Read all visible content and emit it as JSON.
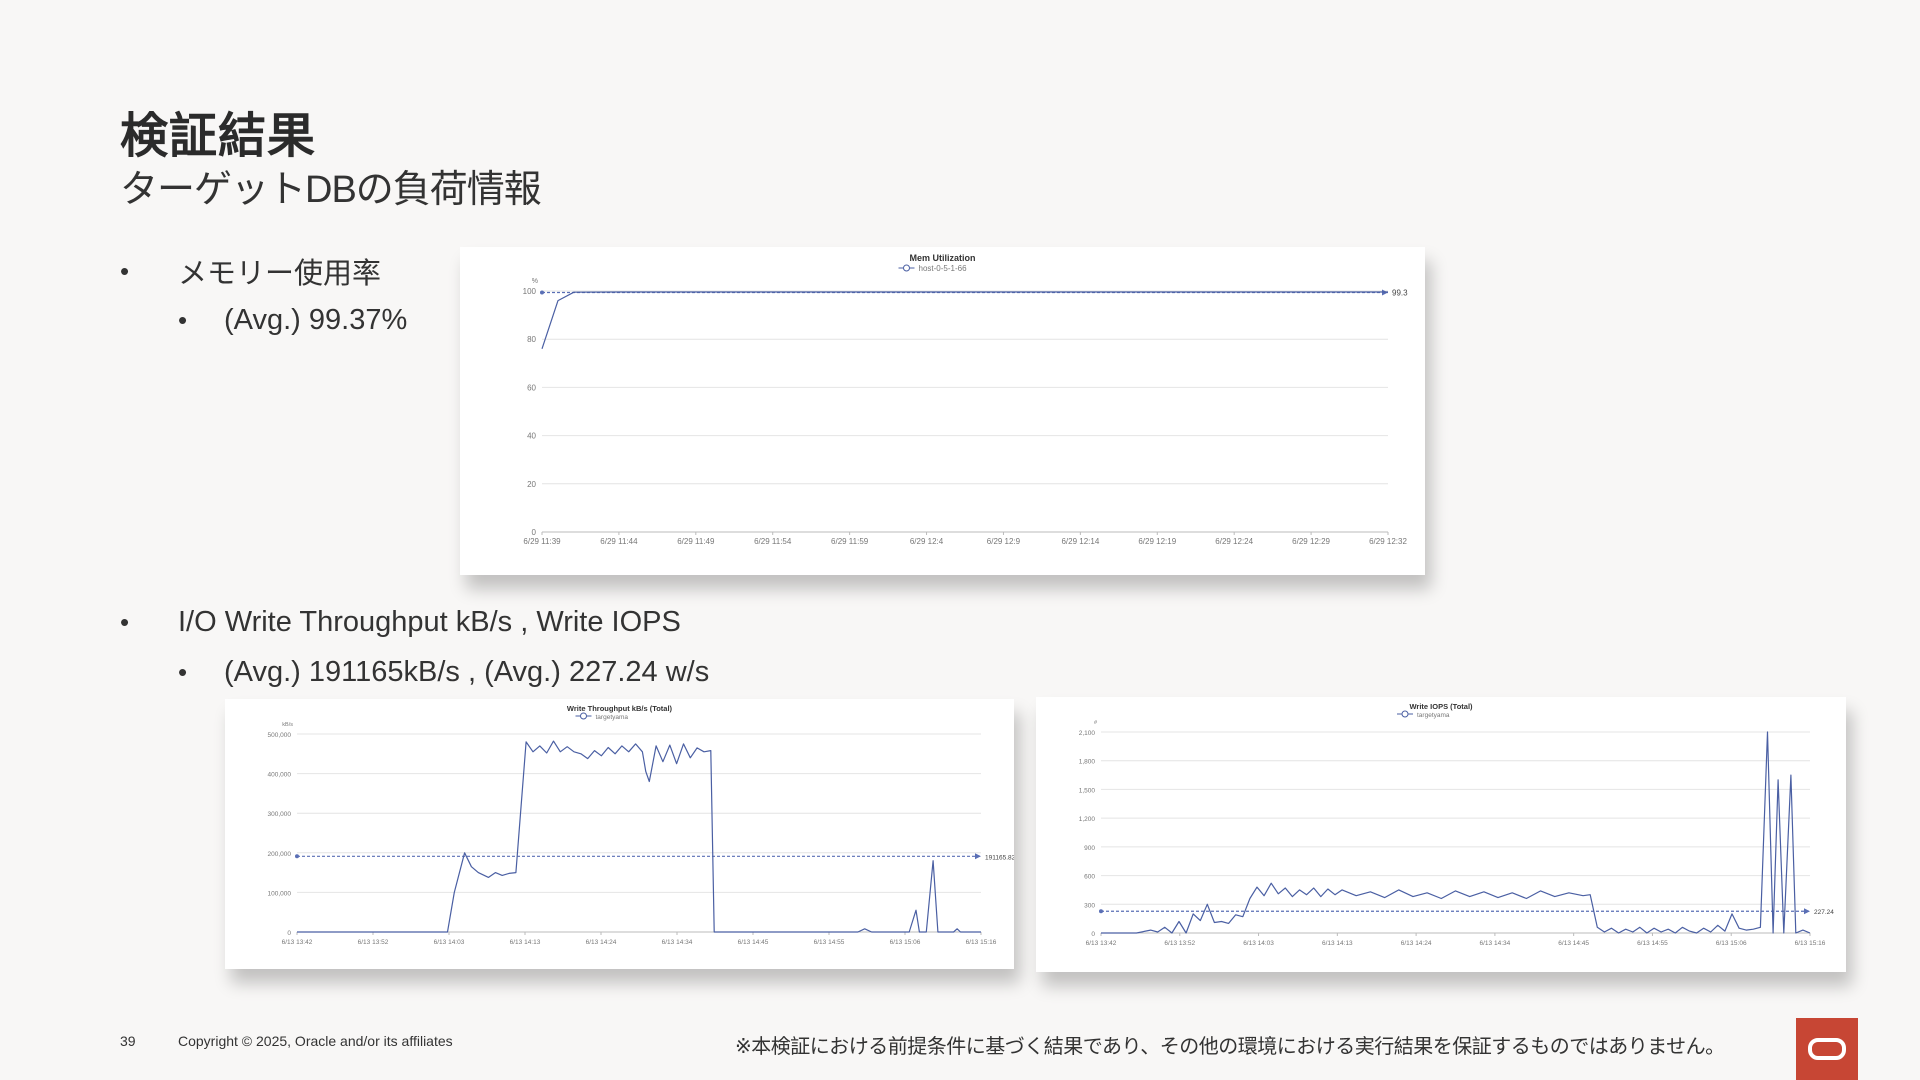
{
  "slide": {
    "title": "検証結果",
    "subtitle": "ターゲットDBの負荷情報",
    "bullets": {
      "mem_label": "メモリー使用率",
      "mem_avg": "(Avg.) 99.37%",
      "io_label": "I/O Write Throughput kB/s , Write IOPS",
      "io_avg": "(Avg.) 191165kB/s , (Avg.) 227.24 w/s"
    },
    "footer": {
      "page_number": "39",
      "copyright": "Copyright © 2025, Oracle and/or its affiliates",
      "disclaimer": "※本検証における前提条件に基づく結果であり、その他の環境における実行結果を保証するものではありません。"
    }
  },
  "colors": {
    "line": "#4a5fa3",
    "avg_line": "#5a6fb5",
    "grid": "#e4e4e4",
    "axis_text": "#777777",
    "oracle_red": "#c74634"
  },
  "chart_data": [
    {
      "type": "line",
      "title": "Mem Utilization",
      "series": [
        {
          "name": "host-0-5-1-66",
          "x": [
            "6/29 11:39",
            "6/29 11:40",
            "6/29 11:41",
            "6/29 11:44",
            "6/29 11:49",
            "6/29 11:54",
            "6/29 11:59",
            "6/29 12:04",
            "6/29 12:09",
            "6/29 12:14",
            "6/29 12:19",
            "6/29 12:24",
            "6/29 12:29",
            "6/29 12:32"
          ],
          "values": [
            76,
            96,
            99.5,
            99.6,
            99.6,
            99.6,
            99.6,
            99.6,
            99.6,
            99.6,
            99.6,
            99.6,
            99.6,
            99.6
          ]
        }
      ],
      "yunit": "%",
      "yticks": [
        "0",
        "20",
        "40",
        "60",
        "80",
        "100"
      ],
      "xticks": [
        "6/29 11:39",
        "6/29 11:44",
        "6/29 11:49",
        "6/29 11:54",
        "6/29 11:59",
        "6/29 12:4",
        "6/29 12:9",
        "6/29 12:14",
        "6/29 12:19",
        "6/29 12:24",
        "6/29 12:29",
        "6/29 12:32"
      ],
      "ylim": [
        0,
        100
      ],
      "x_range": [
        0,
        53
      ],
      "x_offsets": [
        0,
        1,
        2,
        5,
        10,
        15,
        20,
        25,
        30,
        35,
        40,
        45,
        50,
        53
      ],
      "avg": 99.37,
      "avg_label": "99.3",
      "legend_position": "top-center"
    },
    {
      "type": "line",
      "title": "Write Throughput kB/s (Total)",
      "series": [
        {
          "name": "targetyama",
          "x_range": [
            0,
            100
          ],
          "points": [
            [
              0,
              0
            ],
            [
              12,
              0
            ],
            [
              22,
              0
            ],
            [
              23,
              100000
            ],
            [
              24.5,
              200000
            ],
            [
              25.5,
              165000
            ],
            [
              26.5,
              150000
            ],
            [
              28,
              138000
            ],
            [
              29,
              150000
            ],
            [
              30,
              143000
            ],
            [
              31,
              148000
            ],
            [
              32,
              150000
            ],
            [
              33.5,
              480000
            ],
            [
              34.5,
              455000
            ],
            [
              35.5,
              470000
            ],
            [
              36.5,
              452000
            ],
            [
              37.5,
              482000
            ],
            [
              38.5,
              455000
            ],
            [
              39.5,
              468000
            ],
            [
              40.5,
              455000
            ],
            [
              41.5,
              450000
            ],
            [
              42.5,
              438000
            ],
            [
              43.5,
              458000
            ],
            [
              44.5,
              445000
            ],
            [
              45.5,
              466000
            ],
            [
              46.5,
              450000
            ],
            [
              47.5,
              470000
            ],
            [
              48.5,
              455000
            ],
            [
              49.5,
              475000
            ],
            [
              50.5,
              455000
            ],
            [
              51,
              405000
            ],
            [
              51.5,
              380000
            ],
            [
              52.5,
              470000
            ],
            [
              53.5,
              430000
            ],
            [
              54.5,
              472000
            ],
            [
              55.5,
              425000
            ],
            [
              56.5,
              475000
            ],
            [
              57.5,
              440000
            ],
            [
              58.5,
              465000
            ],
            [
              59.5,
              455000
            ],
            [
              60.5,
              458000
            ],
            [
              61,
              0
            ],
            [
              70,
              0
            ],
            [
              82,
              0
            ],
            [
              83,
              8000
            ],
            [
              84,
              0
            ],
            [
              89.5,
              0
            ],
            [
              90.5,
              55000
            ],
            [
              91,
              0
            ],
            [
              92,
              0
            ],
            [
              93,
              180000
            ],
            [
              93.7,
              0
            ],
            [
              96,
              0
            ],
            [
              96.5,
              8000
            ],
            [
              97,
              0
            ],
            [
              100,
              0
            ]
          ]
        }
      ],
      "yunit": "kB/s",
      "yticks": [
        "0",
        "100,000",
        "200,000",
        "300,000",
        "400,000",
        "500,000"
      ],
      "xticks": [
        "6/13 13:42",
        "6/13 13:52",
        "6/13 14:03",
        "6/13 14:13",
        "6/13 14:24",
        "6/13 14:34",
        "6/13 14:45",
        "6/13 14:55",
        "6/13 15:06",
        "6/13 15:16"
      ],
      "ylim": [
        0,
        500000
      ],
      "avg": 191165,
      "avg_label": "191165.82",
      "legend_position": "top-center"
    },
    {
      "type": "line",
      "title": "Write IOPS (Total)",
      "series": [
        {
          "name": "targetyama",
          "x_range": [
            0,
            100
          ],
          "points": [
            [
              0,
              0
            ],
            [
              5,
              0
            ],
            [
              7,
              30
            ],
            [
              8,
              10
            ],
            [
              9,
              60
            ],
            [
              10,
              0
            ],
            [
              11,
              120
            ],
            [
              12,
              0
            ],
            [
              13,
              200
            ],
            [
              14,
              130
            ],
            [
              15,
              300
            ],
            [
              16,
              110
            ],
            [
              17,
              120
            ],
            [
              18,
              100
            ],
            [
              19,
              190
            ],
            [
              20,
              170
            ],
            [
              21,
              360
            ],
            [
              22,
              480
            ],
            [
              23,
              390
            ],
            [
              24,
              520
            ],
            [
              25,
              410
            ],
            [
              26,
              470
            ],
            [
              27,
              380
            ],
            [
              28,
              450
            ],
            [
              29,
              400
            ],
            [
              30,
              470
            ],
            [
              31,
              380
            ],
            [
              32,
              460
            ],
            [
              33,
              400
            ],
            [
              34,
              450
            ],
            [
              36,
              390
            ],
            [
              38,
              430
            ],
            [
              40,
              370
            ],
            [
              42,
              450
            ],
            [
              44,
              380
            ],
            [
              46,
              420
            ],
            [
              48,
              360
            ],
            [
              50,
              440
            ],
            [
              52,
              380
            ],
            [
              54,
              430
            ],
            [
              56,
              370
            ],
            [
              58,
              420
            ],
            [
              60,
              360
            ],
            [
              62,
              440
            ],
            [
              64,
              380
            ],
            [
              66,
              420
            ],
            [
              68,
              390
            ],
            [
              69,
              400
            ],
            [
              70,
              60
            ],
            [
              71,
              10
            ],
            [
              72,
              50
            ],
            [
              73,
              0
            ],
            [
              74,
              40
            ],
            [
              75,
              10
            ],
            [
              76,
              60
            ],
            [
              77,
              0
            ],
            [
              78,
              50
            ],
            [
              79,
              10
            ],
            [
              80,
              40
            ],
            [
              81,
              0
            ],
            [
              82,
              60
            ],
            [
              83,
              20
            ],
            [
              84,
              0
            ],
            [
              85,
              50
            ],
            [
              86,
              10
            ],
            [
              87,
              80
            ],
            [
              88,
              20
            ],
            [
              89,
              200
            ],
            [
              90,
              50
            ],
            [
              91,
              30
            ],
            [
              92,
              40
            ],
            [
              93,
              60
            ],
            [
              94,
              2100
            ],
            [
              94.8,
              0
            ],
            [
              95.5,
              1600
            ],
            [
              96.3,
              0
            ],
            [
              97.3,
              1650
            ],
            [
              98,
              0
            ],
            [
              99,
              30
            ],
            [
              100,
              0
            ]
          ]
        }
      ],
      "yunit": "#",
      "yticks": [
        "0",
        "300",
        "600",
        "900",
        "1,200",
        "1,500",
        "1,800",
        "2,100"
      ],
      "xticks": [
        "6/13 13:42",
        "6/13 13:52",
        "6/13 14:03",
        "6/13 14:13",
        "6/13 14:24",
        "6/13 14:34",
        "6/13 14:45",
        "6/13 14:55",
        "6/13 15:06",
        "6/13 15:16"
      ],
      "ylim": [
        0,
        2100
      ],
      "avg": 227.24,
      "avg_label": "227.24",
      "legend_position": "top-center"
    }
  ]
}
